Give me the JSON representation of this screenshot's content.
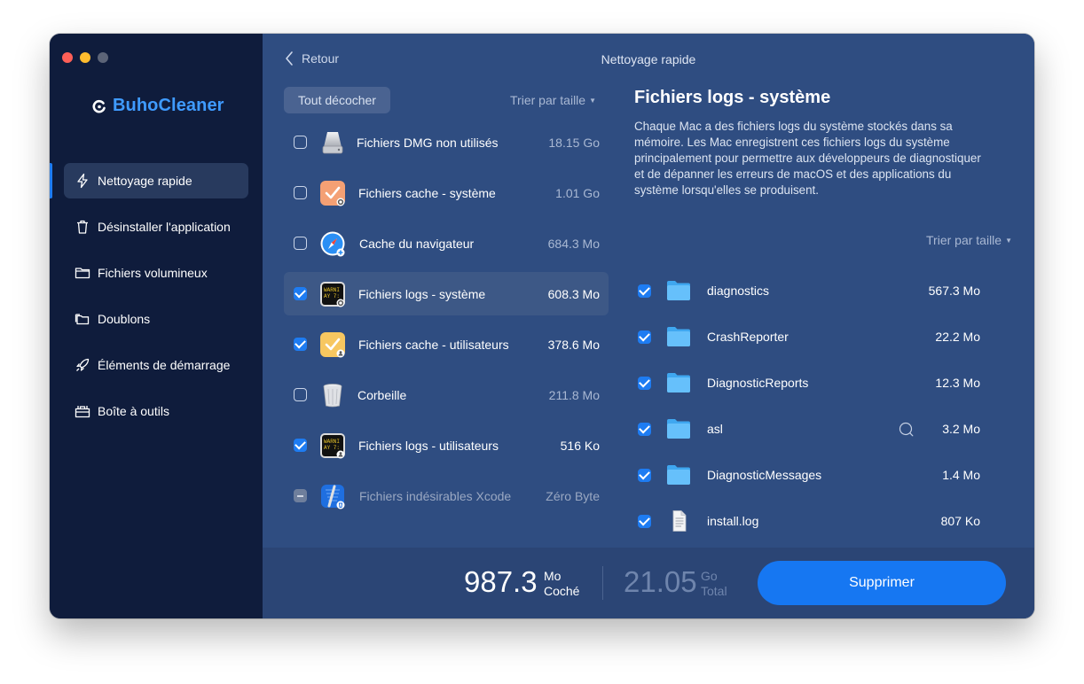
{
  "app": {
    "name": "BuhoCleaner",
    "title": "Nettoyage rapide",
    "back_label": "Retour"
  },
  "colors": {
    "accent": "#1e7cf2",
    "sidebar": "#0f1c3c",
    "main": "#2f4d81",
    "brand": "#3f9bff"
  },
  "sidebar": {
    "items": [
      {
        "label": "Nettoyage rapide",
        "icon": "bolt-icon",
        "active": true
      },
      {
        "label": "Désinstaller l'application",
        "icon": "trash-icon",
        "active": false
      },
      {
        "label": "Fichiers volumineux",
        "icon": "folder-icon",
        "active": false
      },
      {
        "label": "Doublons",
        "icon": "folders-icon",
        "active": false
      },
      {
        "label": "Éléments de démarrage",
        "icon": "rocket-icon",
        "active": false
      },
      {
        "label": "Boîte à outils",
        "icon": "toolbox-icon",
        "active": false
      }
    ]
  },
  "list": {
    "uncheck_label": "Tout décocher",
    "sort_label": "Trier par taille",
    "items": [
      {
        "label": "Fichiers DMG non utilisés",
        "size": "18.15 Go",
        "checked": false,
        "icon": "disk-icon"
      },
      {
        "label": "Fichiers cache - système",
        "size": "1.01 Go",
        "checked": false,
        "icon": "cache-system-icon"
      },
      {
        "label": "Cache du navigateur",
        "size": "684.3 Mo",
        "checked": false,
        "icon": "safari-icon"
      },
      {
        "label": "Fichiers logs - système",
        "size": "608.3 Mo",
        "checked": true,
        "selected": true,
        "icon": "console-system-icon"
      },
      {
        "label": "Fichiers cache - utilisateurs",
        "size": "378.6 Mo",
        "checked": true,
        "icon": "cache-user-icon"
      },
      {
        "label": "Corbeille",
        "size": "211.8 Mo",
        "checked": false,
        "icon": "trash-bin-icon"
      },
      {
        "label": "Fichiers logs - utilisateurs",
        "size": "516 Ko",
        "checked": true,
        "icon": "console-user-icon"
      },
      {
        "label": "Fichiers indésirables Xcode",
        "size": "Zéro Byte",
        "checked": false,
        "disabled": true,
        "icon": "xcode-icon"
      }
    ]
  },
  "detail": {
    "title": "Fichiers logs - système",
    "description": "Chaque Mac a des fichiers logs du système stockés dans sa mémoire. Les Mac enregistrent ces fichiers logs du système principalement pour permettre aux développeurs de diagnostiquer et de dépanner les erreurs de macOS et des applications du système lorsqu'elles se produisent.",
    "sort_label": "Trier par taille",
    "files": [
      {
        "name": "diagnostics",
        "size": "567.3 Mo",
        "checked": true,
        "icon": "folder-icon"
      },
      {
        "name": "CrashReporter",
        "size": "22.2 Mo",
        "checked": true,
        "icon": "folder-icon"
      },
      {
        "name": "DiagnosticReports",
        "size": "12.3 Mo",
        "checked": true,
        "icon": "folder-icon"
      },
      {
        "name": "asl",
        "size": "3.2 Mo",
        "checked": true,
        "icon": "folder-icon",
        "search": true
      },
      {
        "name": "DiagnosticMessages",
        "size": "1.4 Mo",
        "checked": true,
        "icon": "folder-icon"
      },
      {
        "name": "install.log",
        "size": "807 Ko",
        "checked": true,
        "icon": "document-icon"
      }
    ]
  },
  "summary": {
    "checked_value": "987.3",
    "checked_unit": "Mo",
    "checked_label": "Coché",
    "total_value": "21.05",
    "total_unit": "Go",
    "total_label": "Total",
    "delete_label": "Supprimer"
  }
}
